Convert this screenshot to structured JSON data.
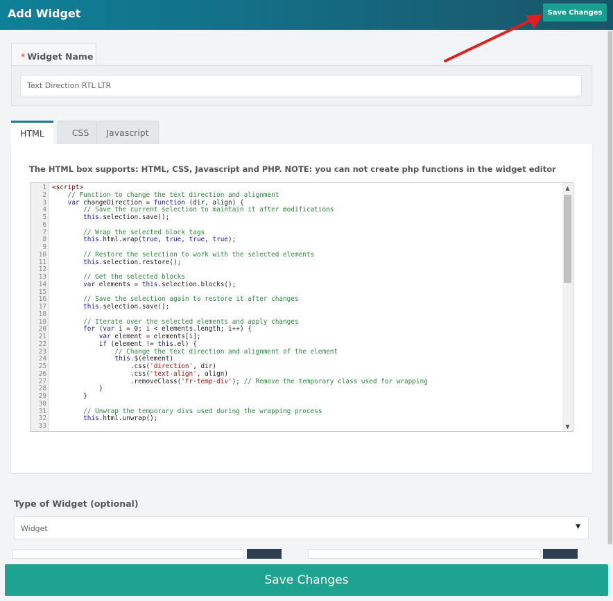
{
  "header": {
    "title": "Add Widget",
    "save_label": "Save Changes"
  },
  "widget_name": {
    "required_mark": "*",
    "label": "Widget Name",
    "value": "Text Direction RTL LTR"
  },
  "tabs": [
    {
      "label": "HTML",
      "active": true
    },
    {
      "label": "CSS",
      "active": false
    },
    {
      "label": "Javascript",
      "active": false
    }
  ],
  "editor": {
    "notice": "The HTML box supports: HTML, CSS, Javascript and PHP. NOTE: you can not create php functions in the widget editor",
    "lines": [
      "<script>",
      "    // Function to change the text direction and alignment",
      "    var changeDirection = function (dir, align) {",
      "        // Save the current selection to maintain it after modifications",
      "        this.selection.save();",
      "",
      "        // Wrap the selected block tags",
      "        this.html.wrap(true, true, true, true);",
      "",
      "        // Restore the selection to work with the selected elements",
      "        this.selection.restore();",
      "",
      "        // Get the selected blocks",
      "        var elements = this.selection.blocks();",
      "",
      "        // Save the selection again to restore it after changes",
      "        this.selection.save();",
      "",
      "        // Iterate over the selected elements and apply changes",
      "        for (var i = 0; i < elements.length; i++) {",
      "            var element = elements[i];",
      "            if (element != this.el) {",
      "                // Change the text direction and alignment of the element",
      "                this.$(element)",
      "                    .css('direction', dir)",
      "                    .css('text-align', align)",
      "                    .removeClass('fr-temp-div'); // Remove the temporary class used for wrapping",
      "            }",
      "        }",
      "",
      "        // Unwrap the temporary divs used during the wrapping process",
      "        this.html.unwrap();",
      ""
    ]
  },
  "widget_type": {
    "label": "Type of Widget (optional)",
    "value": "Widget"
  },
  "footer": {
    "save_label": "Save Changes"
  },
  "colors": {
    "accent": "#1ea390",
    "header": "#146b82",
    "comment": "#2b8a3e",
    "keyword": "#1a1aa6",
    "string": "#a31515"
  },
  "icons": {
    "caret": "caret-down-icon",
    "arrow": "red-arrow-annotation"
  }
}
